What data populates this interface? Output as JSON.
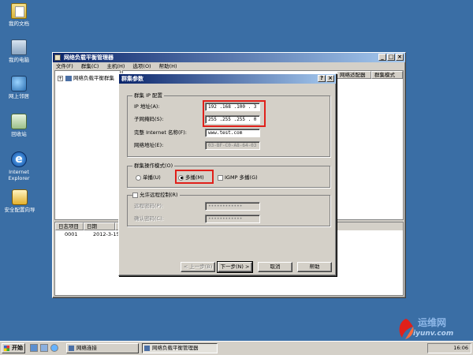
{
  "desktop": {
    "icons": [
      {
        "label": "我的文档",
        "icon": "documents-folder-icon"
      },
      {
        "label": "我的电脑",
        "icon": "my-computer-icon"
      },
      {
        "label": "网上邻居",
        "icon": "network-places-icon"
      },
      {
        "label": "回收站",
        "icon": "recycle-bin-icon"
      },
      {
        "label": "Internet Explorer",
        "icon": "internet-explorer-icon"
      },
      {
        "label": "安全配置向导",
        "icon": "security-wizard-icon"
      }
    ]
  },
  "mmc": {
    "title": "网络负载平衡管理器",
    "menu": [
      "文件(F)",
      "群集(C)",
      "主机(H)",
      "选项(O)",
      "帮助(H)"
    ],
    "tree_root": "网络负载平衡群集",
    "list_columns": [
      "网络适配器",
      "群集模式"
    ],
    "log_columns": [
      "日志项目",
      "日期",
      "时"
    ],
    "log_rows": [
      {
        "id": "0001",
        "date": "2012-3-15",
        "time": "1"
      }
    ]
  },
  "dialog": {
    "title": "群集参数",
    "help_glyph": "?",
    "close_glyph": "×",
    "ip_group": {
      "title": "群集 IP 配置",
      "ip_label": "IP 地址(A):",
      "ip_value": "192 .168 .100 . 3",
      "mask_label": "子网掩码(S):",
      "mask_value": "255 .255 .255 . 0",
      "fqdn_label": "完整 Internet 名称(F):",
      "fqdn_value": "www.test.com",
      "mac_label": "网络地址(E):",
      "mac_value": "03-BF-C0-A8-64-03"
    },
    "mode_group": {
      "title": "群集操作模式(O)",
      "unicast": "单播(U)",
      "multicast": "多播(M)",
      "igmp": "IGMP 多播(G)",
      "selected": "multicast"
    },
    "remote_group": {
      "title": "允许远程控制(R)",
      "pwd_label": "远程密码(P):",
      "pwd_value": "••••••••••••",
      "confirm_label": "确认密码(C):",
      "confirm_value": "••••••••••••"
    },
    "buttons": {
      "back": "< 上一步(B)",
      "next": "下一步(N) >",
      "cancel": "取消",
      "help": "帮助"
    }
  },
  "taskbar": {
    "start": "开始",
    "tasks": [
      "网络连接",
      "网络负载平衡管理器"
    ],
    "clock": "16:06"
  },
  "watermark": {
    "line1": "运维网",
    "line2": "iyunv.com"
  },
  "colors": {
    "desktop": "#3a6ea5",
    "title_active": "#0a246a",
    "highlight": "#e0201a"
  }
}
